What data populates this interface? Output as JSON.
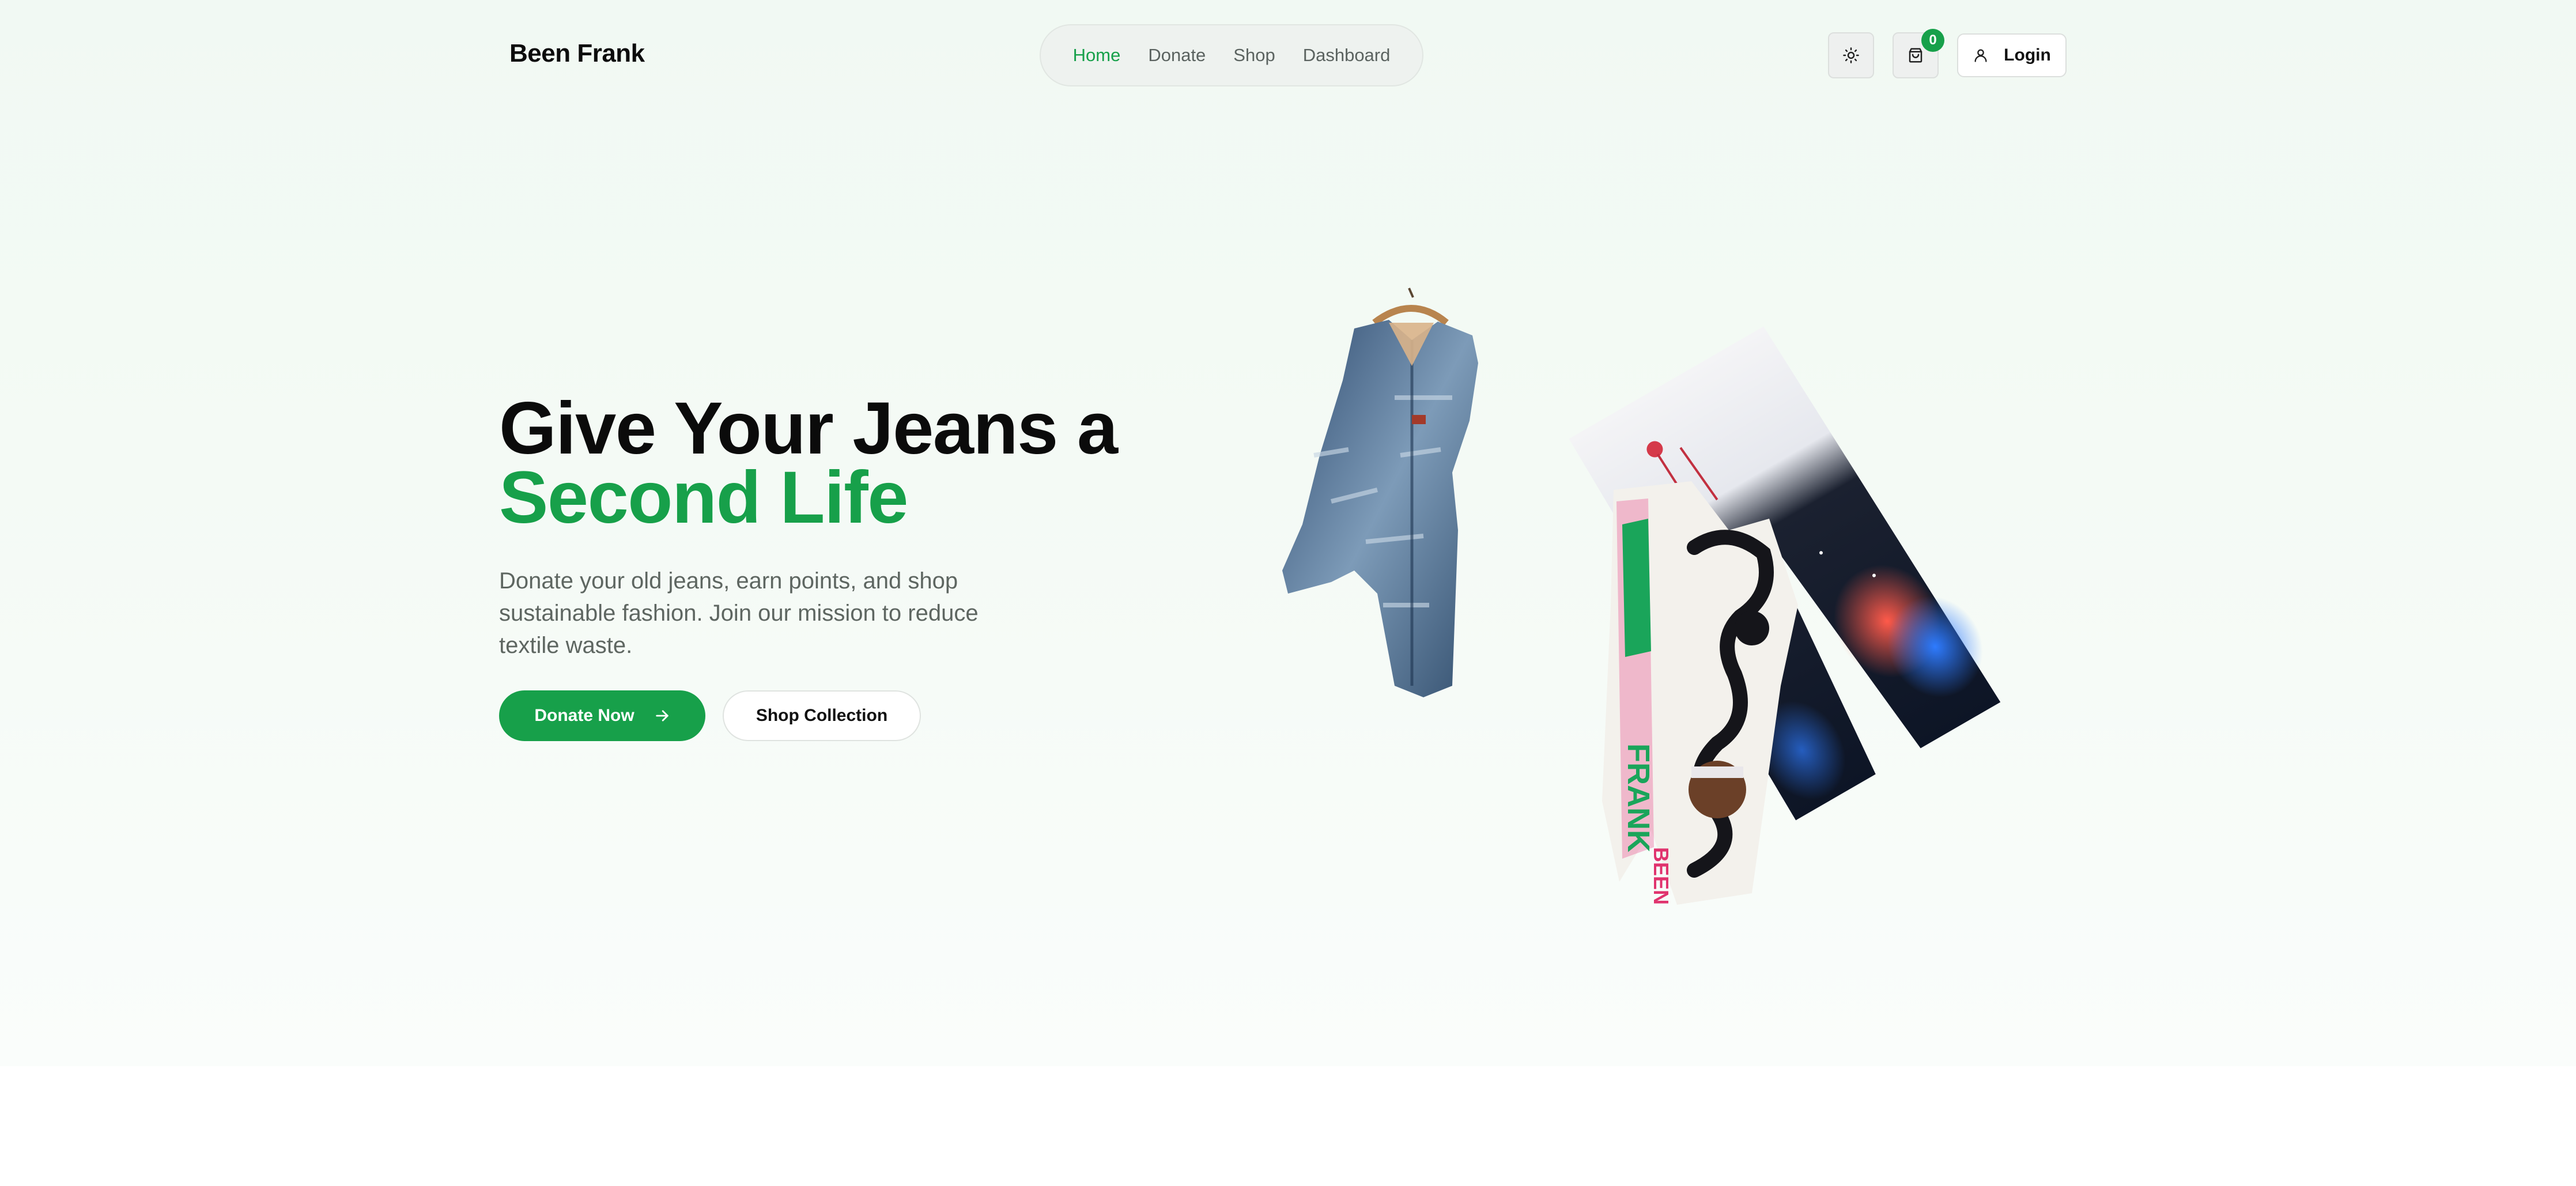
{
  "header": {
    "brand": "Been Frank",
    "nav": [
      {
        "label": "Home",
        "active": true
      },
      {
        "label": "Donate",
        "active": false
      },
      {
        "label": "Shop",
        "active": false
      },
      {
        "label": "Dashboard",
        "active": false
      }
    ],
    "theme_toggle_icon": "sun-icon",
    "cart": {
      "icon": "shopping-bag-icon",
      "count": "0"
    },
    "login": {
      "icon": "user-icon",
      "label": "Login"
    }
  },
  "hero": {
    "headline_line1": "Give Your Jeans a",
    "headline_line2": "Second Life",
    "subtext": "Donate your old jeans, earn points, and shop sustainable fashion. Join our mission to reduce textile waste.",
    "primary_button": {
      "label": "Donate Now",
      "icon": "arrow-right-icon"
    },
    "secondary_button": {
      "label": "Shop Collection"
    },
    "image": {
      "items": [
        "patchwork-denim-jacket-on-hanger",
        "painted-white-jeans-graffiti",
        "painted-jeans-space-flamingo"
      ],
      "graffiti_text": "BEEN FRANK"
    }
  },
  "colors": {
    "accent": "#17a04a",
    "text_dark": "#0b0b0b",
    "text_muted": "#5e6661",
    "hero_background": "#f1f9f3"
  }
}
